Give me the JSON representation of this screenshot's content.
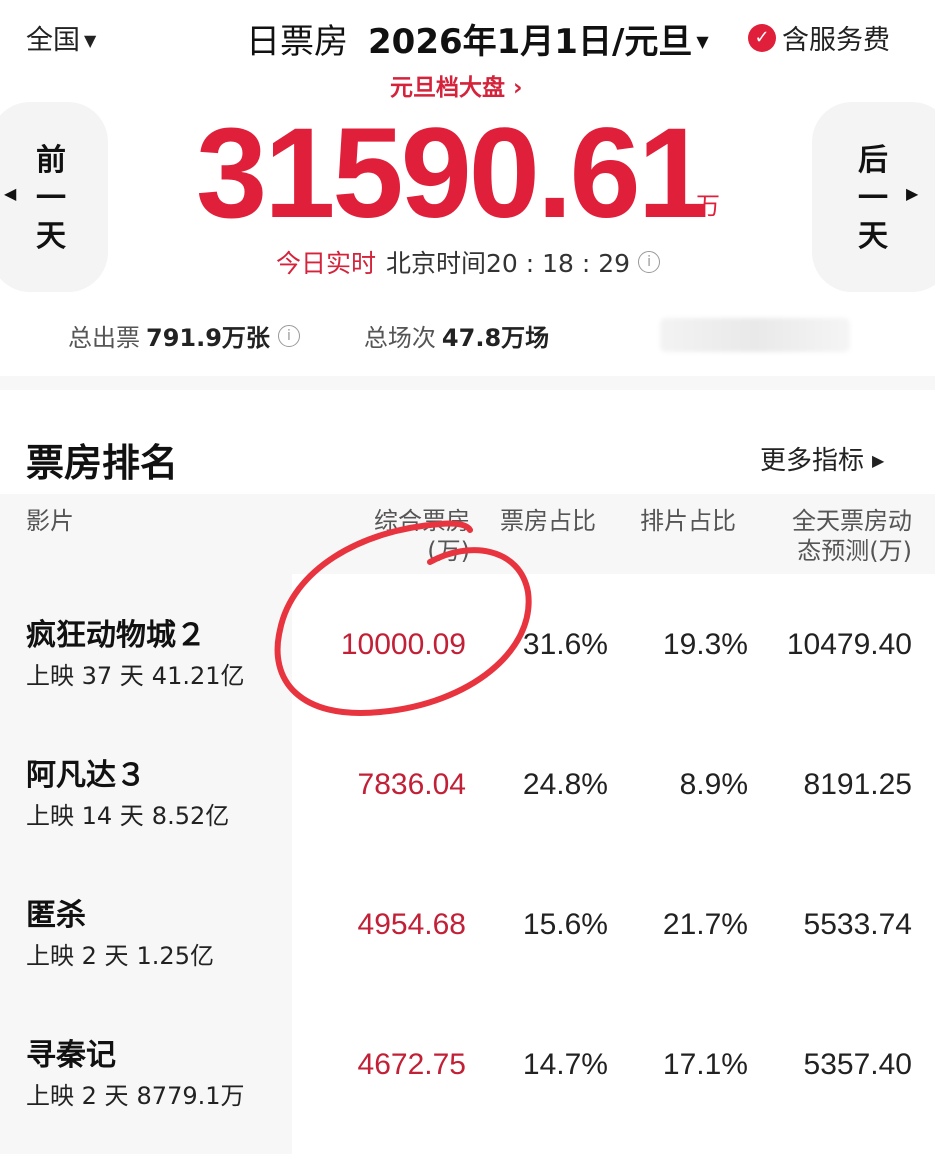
{
  "header": {
    "region": "全国",
    "title_label": "日票房",
    "date": "2026年1月1日/元旦",
    "service_fee": "含服务费",
    "sublink": "元旦档大盘 ›"
  },
  "nav": {
    "prev_day": "前一天",
    "next_day": "后一天"
  },
  "total": {
    "value": "31590.61",
    "unit": "万",
    "realtime_label": "今日实时",
    "time": "北京时间20 : 18 : 29"
  },
  "stats": {
    "tickets_label": "总出票",
    "tickets_value": "791.9万张",
    "shows_label": "总场次",
    "shows_value": "47.8万场"
  },
  "ranking": {
    "title": "票房排名",
    "more": "更多指标",
    "columns": {
      "movie": "影片",
      "gross": "综合票房\n(万)",
      "share": "票房占比",
      "schedule": "排片占比",
      "forecast": "全天票房动\n态预测(万)"
    },
    "rows": [
      {
        "name": "疯狂动物城２",
        "days": "上映 37 天",
        "total": "41.21亿",
        "gross": "10000.09",
        "share": "31.6%",
        "schedule": "19.3%",
        "forecast": "10479.40"
      },
      {
        "name": "阿凡达３",
        "days": "上映 14 天",
        "total": "8.52亿",
        "gross": "7836.04",
        "share": "24.8%",
        "schedule": "8.9%",
        "forecast": "8191.25"
      },
      {
        "name": "匿杀",
        "days": "上映 2 天",
        "total": "1.25亿",
        "gross": "4954.68",
        "share": "15.6%",
        "schedule": "21.7%",
        "forecast": "5533.74"
      },
      {
        "name": "寻秦记",
        "days": "上映 2 天",
        "total": "8779.1万",
        "gross": "4672.75",
        "share": "14.7%",
        "schedule": "17.1%",
        "forecast": "5357.40"
      }
    ]
  },
  "colors": {
    "accent": "#e0203a",
    "gross_text": "#c22036",
    "annotation": "#e8343f"
  }
}
